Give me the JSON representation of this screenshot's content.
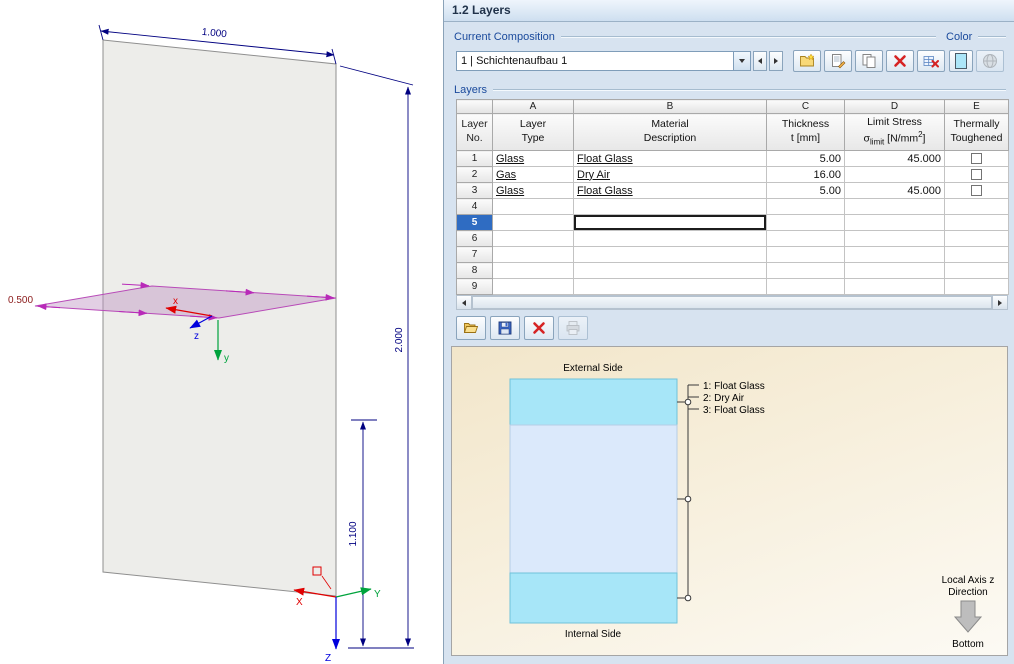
{
  "title": "1.2 Layers",
  "composition": {
    "label": "Current Composition",
    "value": "1 | Schichtenaufbau 1",
    "color_label": "Color"
  },
  "selection": {
    "selected_row": "5",
    "selected_column": "B"
  },
  "layers": {
    "label": "Layers",
    "letters": {
      "a": "A",
      "b": "B",
      "c": "C",
      "d": "D",
      "e": "E"
    },
    "headers": {
      "no1": "Layer",
      "no2": "No.",
      "type1": "Layer",
      "type2": "Type",
      "mat1": "Material",
      "mat2": "Description",
      "th1": "Thickness",
      "th2": "t [mm]",
      "ls1": "Limit Stress",
      "ls_sigma": "σ",
      "ls_sub": "limit",
      "ls_unit_pre": " [N/mm",
      "ls_sup": "2",
      "ls_unit_post": "]",
      "tt1": "Thermally",
      "tt2": "Toughened"
    },
    "rows": [
      {
        "no": "1",
        "type": "Glass",
        "desc": "Float Glass",
        "thickness": "5.00",
        "limit": "45.000"
      },
      {
        "no": "2",
        "type": "Gas",
        "desc": "Dry Air",
        "thickness": "16.00",
        "limit": ""
      },
      {
        "no": "3",
        "type": "Glass",
        "desc": "Float Glass",
        "thickness": "5.00",
        "limit": "45.000"
      },
      {
        "no": "4",
        "type": "",
        "desc": "",
        "thickness": "",
        "limit": ""
      },
      {
        "no": "5",
        "type": "",
        "desc": "",
        "thickness": "",
        "limit": ""
      },
      {
        "no": "6",
        "type": "",
        "desc": "",
        "thickness": "",
        "limit": ""
      },
      {
        "no": "7",
        "type": "",
        "desc": "",
        "thickness": "",
        "limit": ""
      },
      {
        "no": "8",
        "type": "",
        "desc": "",
        "thickness": "",
        "limit": ""
      },
      {
        "no": "9",
        "type": "",
        "desc": "",
        "thickness": "",
        "limit": ""
      }
    ]
  },
  "preview": {
    "external": "External Side",
    "internal": "Internal Side",
    "legend": [
      "1: Float Glass",
      "2: Dry Air",
      "3: Float Glass"
    ],
    "local_axis_1": "Local Axis z",
    "local_axis_2": "Direction",
    "bottom": "Bottom"
  },
  "viewport": {
    "dim_width": "1.000",
    "dim_height": "2.000",
    "dim_partial": "1.100",
    "dim_plane": "0.500",
    "axis_x": "x",
    "axis_y": "y",
    "axis_z": "z",
    "gaxis_x": "X",
    "gaxis_y": "Y",
    "gaxis_z": "Z"
  },
  "colors": {
    "glass_band": "#a7e6f8",
    "gas_band": "#dbe9fb",
    "selection_blue": "#2f6cc2",
    "header_column_blue": "#2e7bd9",
    "dimension_navy": "#000080",
    "plane_magenta": "#b84ab8",
    "swatch": "#ace6f8"
  },
  "icons": {
    "combo_dropdown": "triangle-down",
    "prev_composition": "triangle-left",
    "next_composition": "triangle-right",
    "new_composition": "folder-star",
    "edit_composition": "sheet-pencil",
    "copy_composition": "two-sheets",
    "delete_composition": "red-x",
    "delete_all_compositions": "table-red-x",
    "render_colors": "globe",
    "open": "open-folder",
    "save": "floppy-disk",
    "delete_layers": "red-x",
    "print": "printer",
    "scroll_left": "triangle-left",
    "scroll_right": "triangle-right",
    "local_axis_direction": "block-arrow-down"
  }
}
